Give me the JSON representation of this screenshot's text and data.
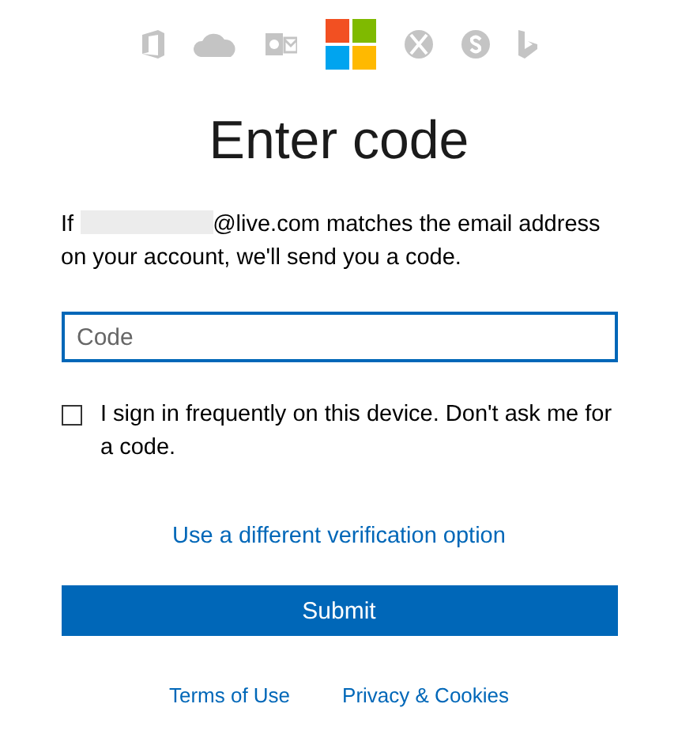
{
  "product_icons": [
    {
      "kind": "office"
    },
    {
      "kind": "cloud"
    },
    {
      "kind": "outlook"
    },
    {
      "kind": "windows"
    },
    {
      "kind": "xbox"
    },
    {
      "kind": "skype"
    },
    {
      "kind": "bing"
    }
  ],
  "title": "Enter code",
  "intro": {
    "prefix": "If",
    "email_masked": true,
    "rest": "@live.com matches the email address on your account, we'll send you a code."
  },
  "code_field": {
    "placeholder": "Code",
    "focused": true
  },
  "remember": {
    "label": "I sign in frequently on this device. Don't ask me for a code.",
    "checked": false
  },
  "alt_link": "Use a different verification option",
  "submit": "Submit",
  "footer_links": [
    "Terms of Use",
    "Privacy & Cookies"
  ]
}
